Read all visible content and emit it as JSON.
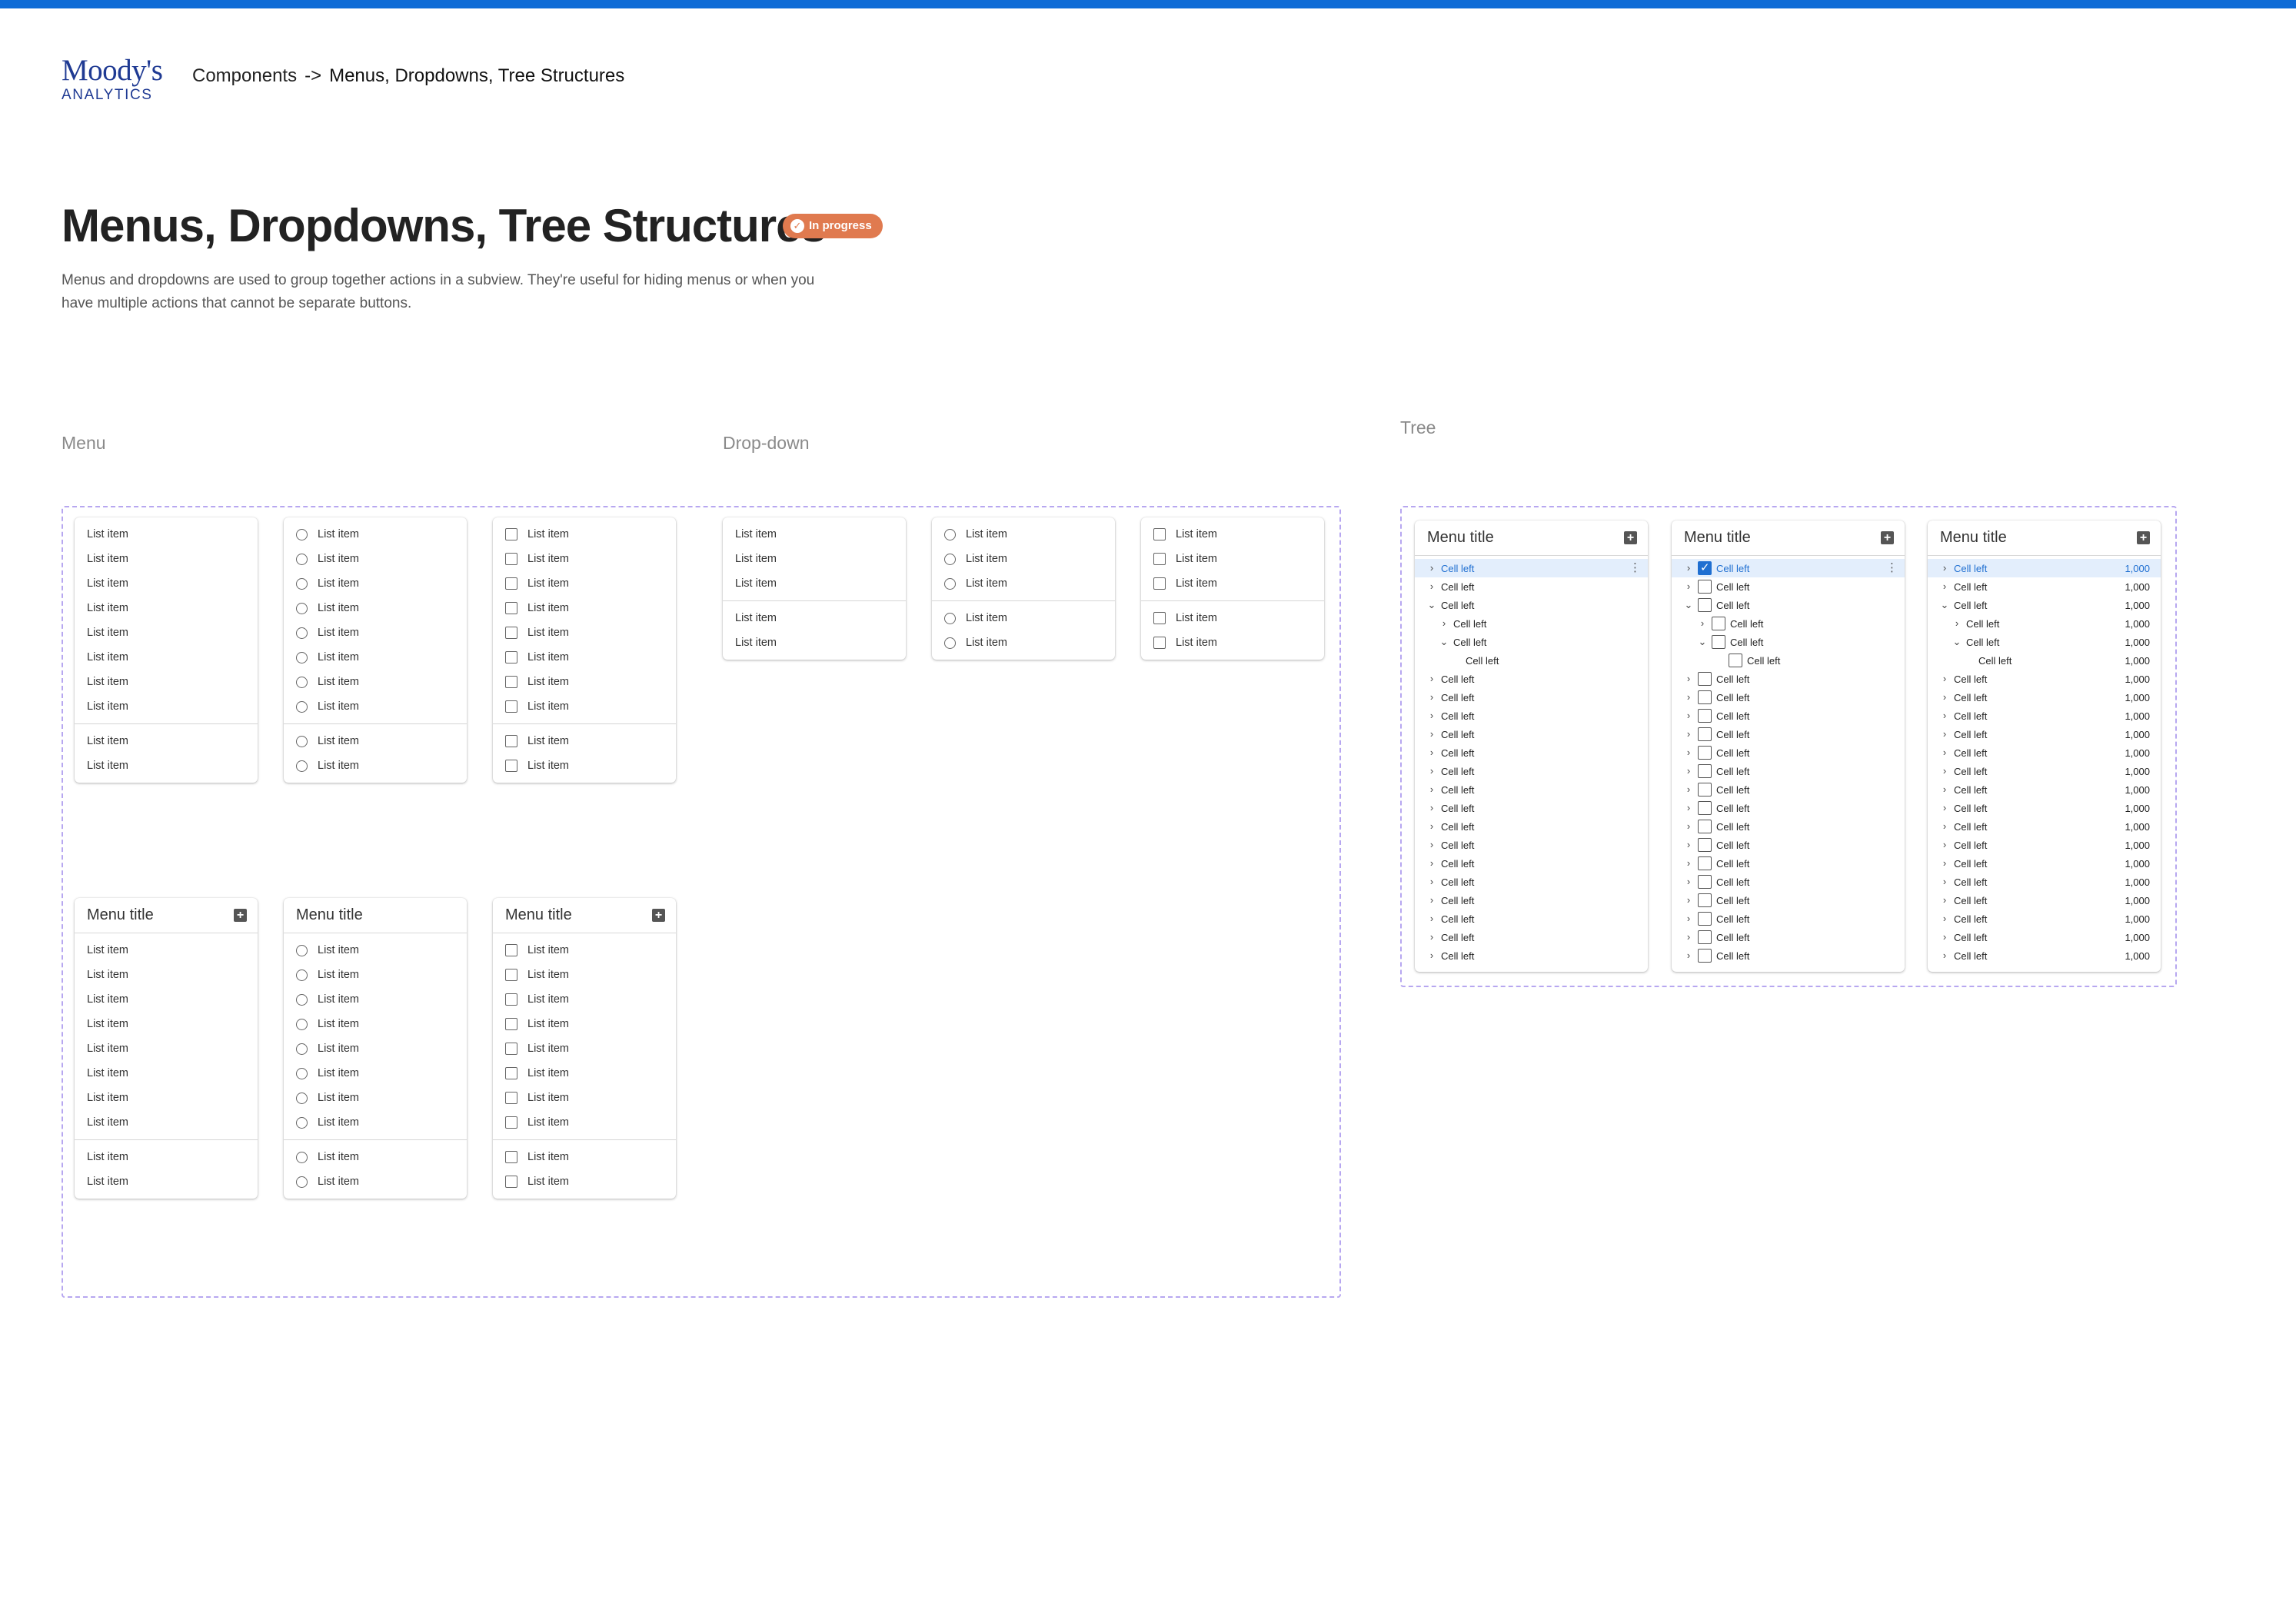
{
  "brand": {
    "name": "Moody's",
    "sub": "ANALYTICS"
  },
  "breadcrumb": {
    "parent": "Components",
    "separator": "->",
    "current": "Menus, Dropdowns, Tree Structures"
  },
  "page": {
    "title": "Menus, Dropdowns, Tree Structures",
    "status": "In progress",
    "description": "Menus and dropdowns are used to group together actions in a subview. They're useful for hiding menus or when you have multiple actions that cannot be separate buttons."
  },
  "sections": {
    "menu": "Menu",
    "dropdown": "Drop-down",
    "tree": "Tree"
  },
  "list_item": "List item",
  "menu_title": "Menu title",
  "tree_cell": "Cell left",
  "tree_value": "1,000",
  "colors": {
    "accent": "#0e6bd6",
    "status": "#e07a4f",
    "frame": "#b7a7f0",
    "selected": "#1f6fd1"
  },
  "icons": {
    "radio": "radio-icon",
    "checkbox": "checkbox-icon",
    "add": "add-icon",
    "caret": "chevron-icon",
    "more": "more-vertical-icon"
  }
}
